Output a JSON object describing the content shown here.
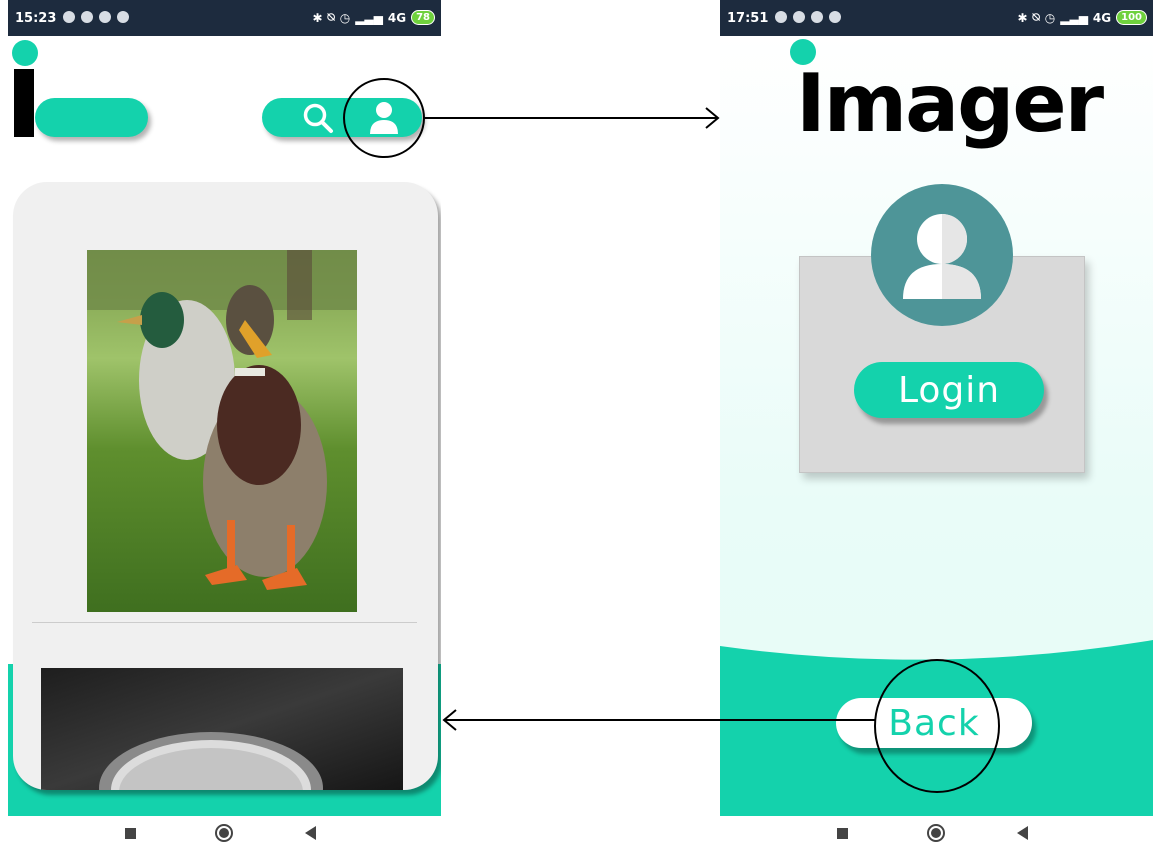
{
  "left_phone": {
    "status_bar": {
      "time": "15:23",
      "network": "4G",
      "battery": "78"
    },
    "header": {
      "search_icon": "search-icon",
      "profile_icon": "user-icon"
    },
    "feed": {
      "images": [
        "duck-photo",
        "bowl-photo"
      ]
    }
  },
  "right_phone": {
    "status_bar": {
      "time": "17:51",
      "network": "4G",
      "battery": "100"
    },
    "app_title": "Imager",
    "avatar_icon": "user-icon",
    "login_label": "Login",
    "back_label": "Back"
  },
  "colors": {
    "accent": "#14d2ac",
    "status_bar": "#1d2b3e",
    "avatar": "#4e9598",
    "card": "#f0f0f0",
    "login_panel": "#d9d9d9"
  }
}
